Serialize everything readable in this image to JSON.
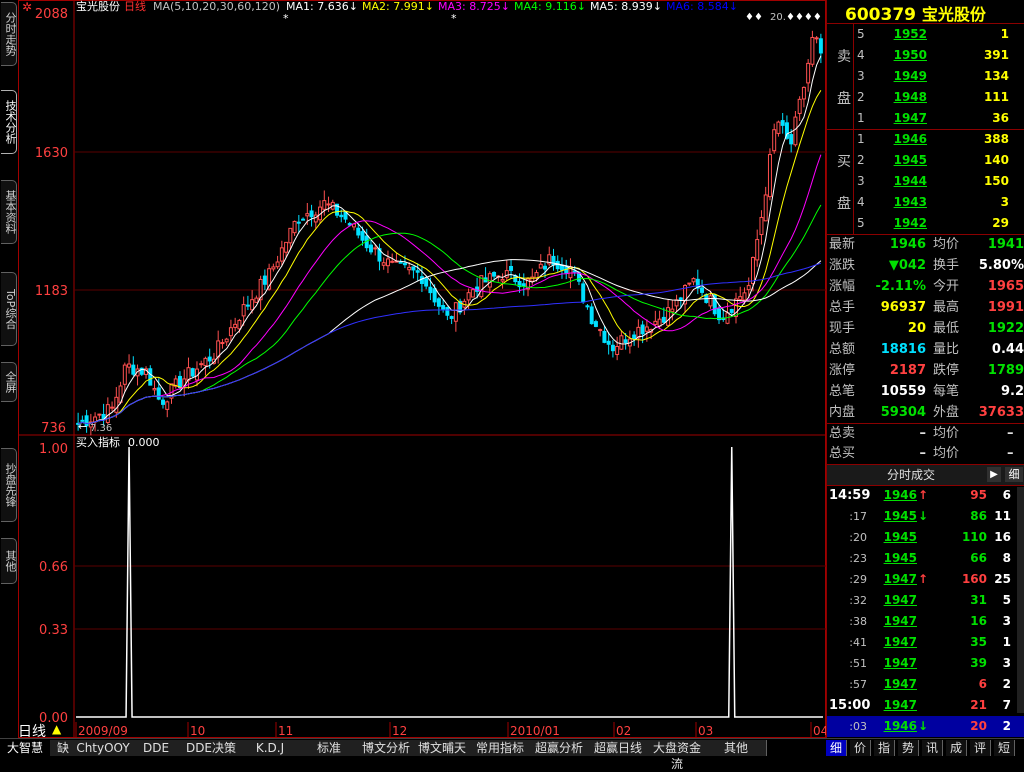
{
  "left_tabs": [
    "分时走势",
    "技术分析",
    "基本资料",
    "ToP综合",
    "全屏",
    "抄盘先锋",
    "其他"
  ],
  "chart_header": {
    "stock_name": "宝光股份",
    "period": "日线",
    "ma_params": "MA(5,10,20,30,60,120)",
    "ma_values": [
      {
        "label": "MA1:",
        "value": "7.636",
        "color": "#ffffff"
      },
      {
        "label": "MA2:",
        "value": "7.991",
        "color": "#ffff00"
      },
      {
        "label": "MA3:",
        "value": "8.725",
        "color": "#ff00ff"
      },
      {
        "label": "MA4:",
        "value": "9.116",
        "color": "#00ff00"
      },
      {
        "label": "MA5:",
        "value": "8.939",
        "color": "#ffffff"
      },
      {
        "label": "MA6:",
        "value": "8.584",
        "color": "#0000ff"
      }
    ]
  },
  "price_axis": [
    "2088",
    "1630",
    "1183",
    "736"
  ],
  "low_marker": "7.36",
  "high_marker": "20.",
  "indicator": {
    "title": "买入指标",
    "value": "0.000",
    "axis": [
      "1.00",
      "0.66",
      "0.33",
      "0.00"
    ],
    "spikes_at_day": [
      12,
      154
    ]
  },
  "date_axis": [
    "2009/09",
    "10",
    "11",
    "12",
    "2010/01",
    "02",
    "03",
    "04"
  ],
  "period_label": "日线",
  "panel": {
    "code": "600379",
    "name": "宝光股份",
    "sell_label": [
      "卖",
      "盘"
    ],
    "buy_label": [
      "买",
      "盘"
    ],
    "sell": [
      {
        "level": "5",
        "price": "1952",
        "vol": "1"
      },
      {
        "level": "4",
        "price": "1950",
        "vol": "391"
      },
      {
        "level": "3",
        "price": "1949",
        "vol": "134"
      },
      {
        "level": "2",
        "price": "1948",
        "vol": "111"
      },
      {
        "level": "1",
        "price": "1947",
        "vol": "36"
      }
    ],
    "buy": [
      {
        "level": "1",
        "price": "1946",
        "vol": "388"
      },
      {
        "level": "2",
        "price": "1945",
        "vol": "140"
      },
      {
        "level": "3",
        "price": "1944",
        "vol": "150"
      },
      {
        "level": "4",
        "price": "1943",
        "vol": "3"
      },
      {
        "level": "5",
        "price": "1942",
        "vol": "29"
      }
    ],
    "quotes": [
      {
        "l": "最新",
        "v": "1946",
        "vc": "#00e000",
        "l2": "均价",
        "v2": "1941",
        "v2c": "#00e000"
      },
      {
        "l": "涨跌",
        "v": "▼042",
        "vc": "#00e000",
        "l2": "换手",
        "v2": "5.80%",
        "v2c": "#ffffff"
      },
      {
        "l": "涨幅",
        "v": "-2.11%",
        "vc": "#00e000",
        "l2": "今开",
        "v2": "1965",
        "v2c": "#ff4040"
      },
      {
        "l": "总手",
        "v": "96937",
        "vc": "#ffff00",
        "l2": "最高",
        "v2": "1991",
        "v2c": "#ff4040"
      },
      {
        "l": "现手",
        "v": "20",
        "vc": "#ffff00",
        "l2": "最低",
        "v2": "1922",
        "v2c": "#00e000"
      },
      {
        "l": "总额",
        "v": "18816",
        "vc": "#00e0ff",
        "l2": "量比",
        "v2": "0.44",
        "v2c": "#ffffff"
      },
      {
        "l": "涨停",
        "v": "2187",
        "vc": "#ff4040",
        "l2": "跌停",
        "v2": "1789",
        "v2c": "#00e000"
      },
      {
        "l": "总笔",
        "v": "10559",
        "vc": "#ffffff",
        "l2": "每笔",
        "v2": "9.2",
        "v2c": "#ffffff"
      },
      {
        "l": "内盘",
        "v": "59304",
        "vc": "#00e000",
        "l2": "外盘",
        "v2": "37633",
        "v2c": "#ff4040"
      }
    ],
    "summary": [
      {
        "l": "总卖",
        "v": "–",
        "l2": "均价",
        "v2": "–"
      },
      {
        "l": "总买",
        "v": "–",
        "l2": "均价",
        "v2": "–"
      }
    ],
    "ticks_title": "分时成交",
    "ticks_btn": "细",
    "ticks": [
      {
        "t": "14:59",
        "p": "1946",
        "a": "↑",
        "v": "95",
        "n": "6",
        "dir": "up"
      },
      {
        "t": ":17",
        "p": "1945",
        "a": "↓",
        "v": "86",
        "n": "11",
        "dir": "dn"
      },
      {
        "t": ":20",
        "p": "1945",
        "a": "",
        "v": "110",
        "n": "16",
        "dir": "dn"
      },
      {
        "t": ":23",
        "p": "1945",
        "a": "",
        "v": "66",
        "n": "8",
        "dir": "dn"
      },
      {
        "t": ":29",
        "p": "1947",
        "a": "↑",
        "v": "160",
        "n": "25",
        "dir": "up"
      },
      {
        "t": ":32",
        "p": "1947",
        "a": "",
        "v": "31",
        "n": "5",
        "dir": "dn"
      },
      {
        "t": ":38",
        "p": "1947",
        "a": "",
        "v": "16",
        "n": "3",
        "dir": "dn"
      },
      {
        "t": ":41",
        "p": "1947",
        "a": "",
        "v": "35",
        "n": "1",
        "dir": "dn"
      },
      {
        "t": ":51",
        "p": "1947",
        "a": "",
        "v": "39",
        "n": "3",
        "dir": "dn"
      },
      {
        "t": ":57",
        "p": "1947",
        "a": "",
        "v": "6",
        "n": "2",
        "dir": "up"
      },
      {
        "t": "15:00",
        "p": "1947",
        "a": "",
        "v": "21",
        "n": "7",
        "dir": "up"
      },
      {
        "t": ":03",
        "p": "1946",
        "a": "↓",
        "v": "20",
        "n": "2",
        "dir": "up"
      }
    ],
    "bottom_tabs": [
      "细",
      "价",
      "指",
      "势",
      "讯",
      "成",
      "评",
      "短"
    ]
  },
  "bottom_tabs": [
    "大智慧",
    "缺",
    "ChtyOOY",
    "DDE",
    "DDE决策",
    "K.D.J",
    "标准",
    "博文分析",
    "博文晡天",
    "常用指标",
    "超赢分析",
    "超赢日线",
    "大盘资金流",
    "其他"
  ]
}
